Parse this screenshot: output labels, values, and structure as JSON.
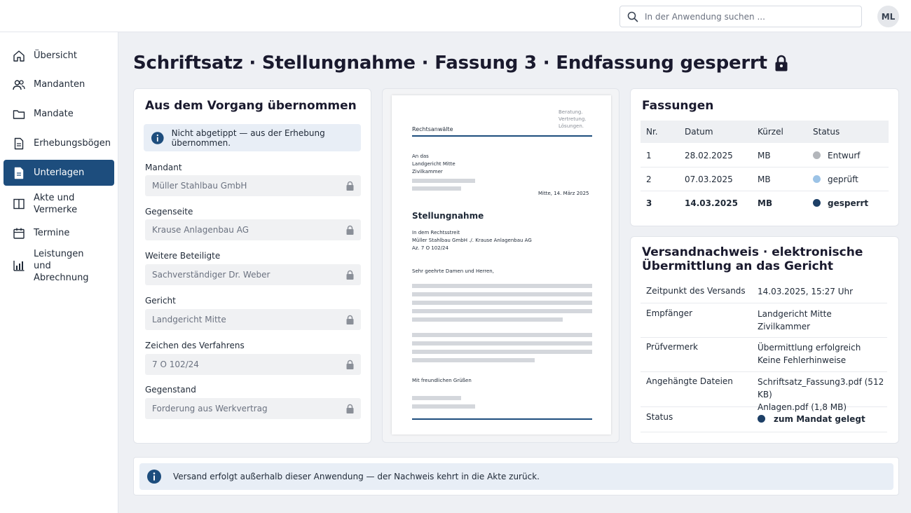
{
  "search": {
    "placeholder": "In der Anwendung suchen ..."
  },
  "user": {
    "initials": "ML"
  },
  "sidebar": {
    "items": [
      {
        "label": "Übersicht",
        "icon": "home-icon"
      },
      {
        "label": "Mandanten",
        "icon": "users-icon"
      },
      {
        "label": "Mandate",
        "icon": "folder-icon"
      },
      {
        "label": "Erhebungsbögen",
        "icon": "document-icon"
      },
      {
        "label": "Unterlagen",
        "icon": "document-icon",
        "active": true
      },
      {
        "label": "Akte und Vermerke",
        "icon": "book-icon"
      },
      {
        "label": "Termine",
        "icon": "calendar-icon"
      },
      {
        "label": "Leistungen und Abrechnung",
        "icon": "chart-icon"
      }
    ]
  },
  "page": {
    "title": "Schriftsatz · Stellungnahme · Fassung 3 · Endfassung gesperrt"
  },
  "source": {
    "title": "Aus dem Vorgang übernommen",
    "info": "Nicht abgetippt — aus der Erhebung übernommen.",
    "fields": [
      {
        "label": "Mandant",
        "value": "Müller Stahlbau GmbH"
      },
      {
        "label": "Gegenseite",
        "value": "Krause Anlagenbau AG"
      },
      {
        "label": "Weitere Beteiligte",
        "value": "Sachverständiger Dr. Weber"
      },
      {
        "label": "Gericht",
        "value": "Landgericht Mitte"
      },
      {
        "label": "Zeichen des Verfahrens",
        "value": "7 O 102/24"
      },
      {
        "label": "Gegenstand",
        "value": "Forderung aus Werkvertrag"
      }
    ]
  },
  "document": {
    "firm": "Rechtsanwälte",
    "slogan": [
      "Beratung.",
      "Vertretung.",
      "Lösungen."
    ],
    "recipient": [
      "An das",
      "Landgericht Mitte",
      "Zivilkammer"
    ],
    "date_line": "Mitte, 14. März 2025",
    "heading": "Stellungnahme",
    "case_lines": [
      "In dem Rechtsstreit",
      "Müller Stahlbau GmbH ./. Krause Anlagenbau AG",
      "Az. 7 O 102/24"
    ],
    "salutation": "Sehr geehrte Damen und Herren,",
    "closing": "Mit freundlichen Grüßen"
  },
  "versions": {
    "title": "Fassungen",
    "headers": [
      "Nr.",
      "Datum",
      "Kürzel",
      "Status"
    ],
    "rows": [
      {
        "nr": "1",
        "date": "28.02.2025",
        "abbr": "MB",
        "status": "Entwurf",
        "color": "#b3b6bb"
      },
      {
        "nr": "2",
        "date": "07.03.2025",
        "abbr": "MB",
        "status": "geprüft",
        "color": "#9cc3e6"
      },
      {
        "nr": "3",
        "date": "14.03.2025",
        "abbr": "MB",
        "status": "gesperrt",
        "color": "#1d3f66"
      }
    ]
  },
  "dispatch": {
    "title": "Versandnachweis · elektronische Übermittlung an das Gericht",
    "rows": [
      {
        "key": "Zeitpunkt des Versands",
        "lines": [
          "14.03.2025, 15:27 Uhr"
        ]
      },
      {
        "key": "Empfänger",
        "lines": [
          "Landgericht Mitte",
          "Zivilkammer"
        ]
      },
      {
        "key": "Prüfvermerk",
        "lines": [
          "Übermittlung erfolgreich",
          "Keine Fehlerhinweise"
        ]
      },
      {
        "key": "Angehängte Dateien",
        "lines": [
          "Schriftsatz_Fassung3.pdf (512 KB)",
          "Anlagen.pdf (1,8 MB)"
        ]
      },
      {
        "key": "Status",
        "lines": [
          "zum Mandat gelegt"
        ],
        "color": "#1d3f66"
      }
    ]
  },
  "footer": {
    "info": "Versand erfolgt außerhalb dieser Anwendung — der Nachweis kehrt in die Akte zurück."
  },
  "colors": {
    "accent": "#1d4d7d",
    "info": "#1d4d7d",
    "locked": "#1d3f66"
  }
}
